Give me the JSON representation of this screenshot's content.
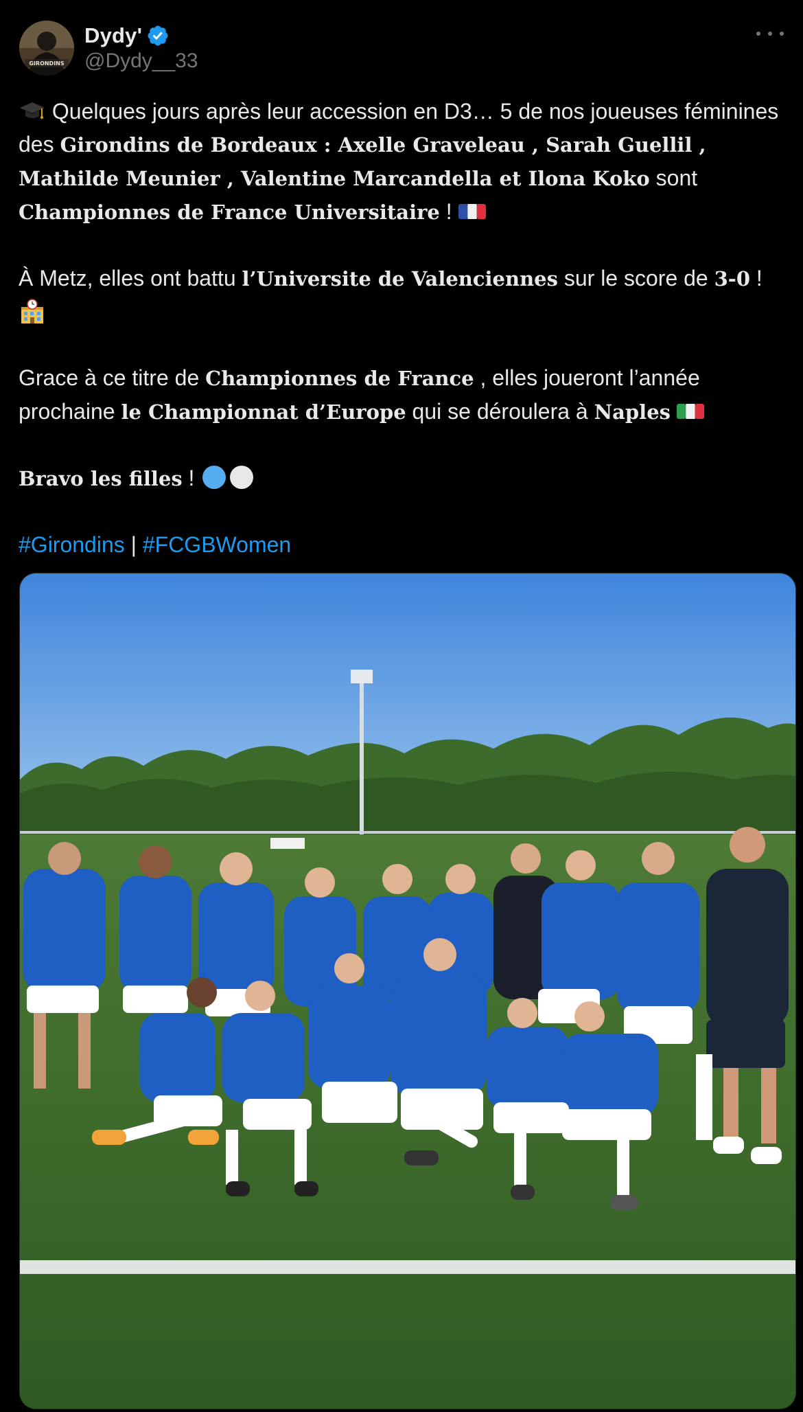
{
  "tweet": {
    "author": {
      "display_name": "Dydy'",
      "handle": "@Dydy__33",
      "verified": true,
      "avatar_text": "GIRONDINS"
    },
    "more_icon": "more-horizontal-icon",
    "paragraphs": {
      "p1": {
        "emoji": "graduation-cap",
        "t1": " Quelques jours après leur accession en D3… 5 de nos joueuses féminines des ",
        "b1": "Girondins de Bordeaux : Axelle Graveleau , Sarah Guellil , Mathilde Meunier , Valentine Marcandella et Ilona Koko",
        "t2": " sont ",
        "b2": "Championnes de France Universitaire",
        "t3": " ! ",
        "flag": "france-flag"
      },
      "p2": {
        "t1": "À Metz, elles ont battu ",
        "b1": "l’Universite de Valenciennes",
        "t2": " sur le score de ",
        "b2": "3-0",
        "t3": " ! ",
        "emoji": "school-building"
      },
      "p3": {
        "t1": "Grace à ce titre de ",
        "b1": "Championnes de France",
        "t2": " , elles joueront l’année prochaine ",
        "b2": "le Championnat d’Europe",
        "t3": " qui se déroulera à ",
        "b3": "Naples",
        "t4": " ",
        "flag": "italy-flag"
      },
      "p4": {
        "b1": "Bravo les filles",
        "t1": " ! ",
        "emoji1": "blue-circle",
        "emoji2": "white-circle"
      },
      "p5": {
        "tag1": "#Girondins",
        "sep": " | ",
        "tag2": "#FCGBWomen"
      }
    },
    "media": {
      "type": "photo",
      "banner_text": "",
      "colors": {
        "sky": "#4a8fe0",
        "grass": "#3e6b2a",
        "jersey": "#1f5fc4",
        "shorts": "#ffffff"
      }
    },
    "colors": {
      "background": "#000000",
      "text": "#e7e9ea",
      "secondary": "#71767b",
      "link": "#1d9bf0",
      "verified": "#1d9bf0"
    }
  }
}
